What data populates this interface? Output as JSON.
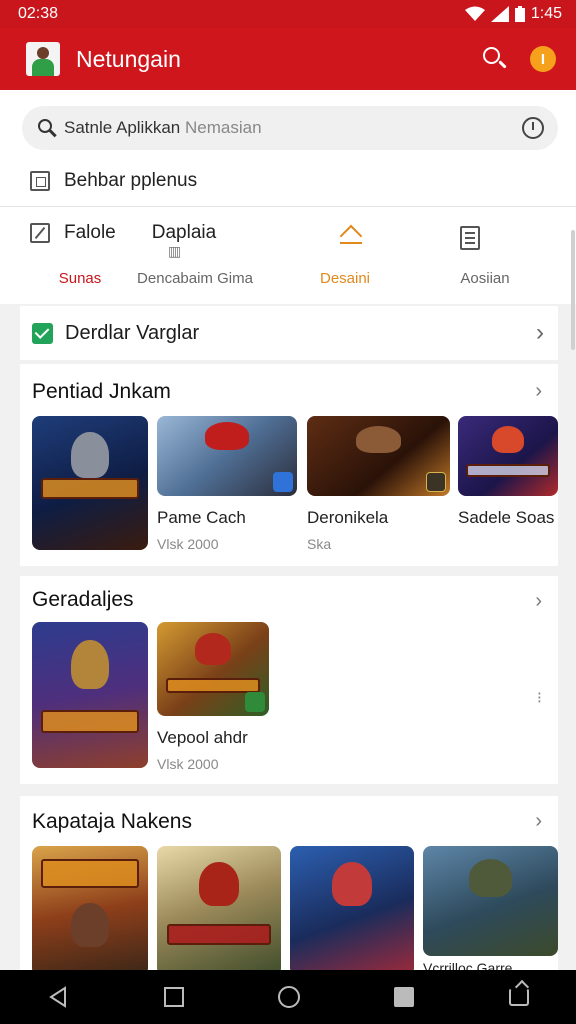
{
  "status_bar": {
    "time": "02:38",
    "clock": "1:45",
    "icons": [
      "wifi-icon",
      "signal-icon",
      "battery-icon"
    ]
  },
  "app_bar": {
    "title": "Netungain",
    "coin_label": "I",
    "colors": {
      "primary": "#d0161d",
      "coin": "#f6a11c"
    }
  },
  "search": {
    "query": "Satnle Aplikkan",
    "placeholder": "Nemasian"
  },
  "header_rows": [
    {
      "label": "Behbar pplenus",
      "icon": "frame-icon"
    },
    {
      "label": "Falole",
      "icon": "edit-icon"
    }
  ],
  "overlay_label": "Daplaia",
  "tabs": [
    {
      "label": "Sunas",
      "state": "active",
      "color": "#c8161c"
    },
    {
      "label": "Dencabaim Gima",
      "icon": "grid-icon"
    },
    {
      "label": "Desaini",
      "icon": "hat-icon",
      "color": "#e08a1e"
    },
    {
      "label": "Aosiian",
      "icon": "document-icon"
    }
  ],
  "check_row": {
    "label": "Derdlar Varglar",
    "accent": "#22a35a"
  },
  "sections": [
    {
      "title": "Pentiad Jnkam",
      "cards": [
        {
          "title": "",
          "subtitle": "",
          "art": "armored-warrior",
          "logo_text": "NOMKADIAA"
        },
        {
          "title": "Pame Cach",
          "subtitle": "Vlsk 2000",
          "art": "red-helmet-rifle"
        },
        {
          "title": "Deronikela",
          "subtitle": "Ska",
          "art": "armored-hero"
        },
        {
          "title": "Sadele Soas",
          "subtitle": "",
          "art": "dragon-logo",
          "logo_text": "DARMY WORBAN"
        }
      ]
    },
    {
      "title": "Geradaljes",
      "cards": [
        {
          "title": "",
          "subtitle": "",
          "art": "hero-group",
          "logo_text": "SMOEGH"
        },
        {
          "title": "Vepool ahdr",
          "subtitle": "Vlsk 2000",
          "art": "red-beast",
          "logo_text": "DONICTOR"
        }
      ]
    },
    {
      "title": "Kapataja Nakens",
      "cards": [
        {
          "title": "",
          "subtitle": "",
          "art": "logo-warriors",
          "logo_text": "COKFIN"
        },
        {
          "title": "",
          "subtitle": "",
          "art": "red-warrior",
          "logo_text": "BATTLEFORCE"
        },
        {
          "title": "",
          "subtitle": "",
          "art": "swordfight"
        },
        {
          "title": "Vcrrilloc Garre",
          "subtitle": "",
          "art": "soldiers"
        }
      ]
    }
  ],
  "nav_bar": [
    "back-icon",
    "recent-apps-icon",
    "home-icon",
    "stop-icon",
    "rotate-icon"
  ]
}
